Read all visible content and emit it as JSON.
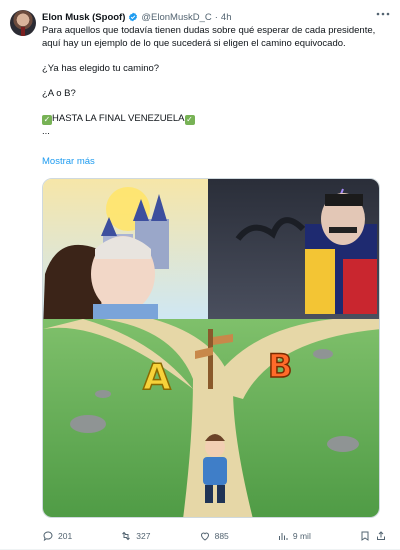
{
  "author": {
    "name": "Elon Musk (Spoof)",
    "handle": "@ElonMuskD_C",
    "separator": "·",
    "time": "4h"
  },
  "tweet": {
    "line1": "Para aquellos que todavía tienen dudas sobre qué esperar de cada presidente, aquí hay un ejemplo de lo que sucederá si eligen el camino equivocado.",
    "line2": "¿Ya has elegido tu camino?",
    "line3": "¿A o B?",
    "line4": "HASTA LA FINAL VENEZUELA",
    "ellipsis": "...",
    "show_more": "Mostrar más"
  },
  "image": {
    "label_a": "A",
    "label_b": "B"
  },
  "actions": {
    "replies": "201",
    "retweets": "327",
    "likes": "885",
    "views": "9 mil"
  },
  "colors": {
    "accent": "#1d9bf0",
    "retweet": "#00ba7c",
    "muted": "#536471",
    "check_emoji": "#77b255"
  },
  "icons": {
    "verified": "verified-badge-icon",
    "more": "more-options-icon",
    "reply": "reply-icon",
    "retweet": "retweet-icon",
    "like": "heart-icon",
    "views": "views-icon",
    "bookmark": "bookmark-icon",
    "share": "share-icon"
  }
}
